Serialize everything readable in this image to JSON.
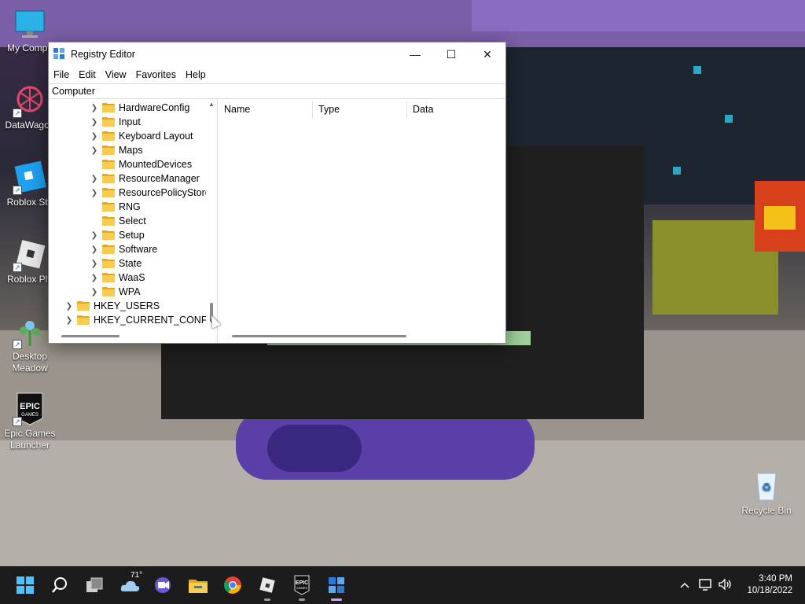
{
  "desktop": {
    "icons": [
      {
        "name": "My Compu",
        "label": "My Compu"
      },
      {
        "name": "DataWagon",
        "label": "DataWagon"
      },
      {
        "name": "Roblox Studio",
        "label": "Roblox Stu"
      },
      {
        "name": "Roblox Player",
        "label": "Roblox Pla"
      },
      {
        "name": "Desktop Meadow",
        "label": "Desktop Meadow"
      },
      {
        "name": "Epic Games Launcher",
        "label": "Epic Games Launcher",
        "badge": "EPIC GAMES"
      },
      {
        "name": "Recycle Bin",
        "label": "Recycle Bin"
      }
    ]
  },
  "window": {
    "title": "Registry Editor",
    "controls": {
      "minimize": "—",
      "maximize": "☐",
      "close": "✕"
    },
    "menu": [
      "File",
      "Edit",
      "View",
      "Favorites",
      "Help"
    ],
    "address": "Computer",
    "tree": [
      {
        "label": "HardwareConfig",
        "expandable": true,
        "level": 2
      },
      {
        "label": "Input",
        "expandable": true,
        "level": 2
      },
      {
        "label": "Keyboard Layout",
        "expandable": true,
        "level": 2
      },
      {
        "label": "Maps",
        "expandable": true,
        "level": 2
      },
      {
        "label": "MountedDevices",
        "expandable": false,
        "level": 2
      },
      {
        "label": "ResourceManager",
        "expandable": true,
        "level": 2
      },
      {
        "label": "ResourcePolicyStore",
        "expandable": true,
        "level": 2
      },
      {
        "label": "RNG",
        "expandable": false,
        "level": 2
      },
      {
        "label": "Select",
        "expandable": false,
        "level": 2
      },
      {
        "label": "Setup",
        "expandable": true,
        "level": 2
      },
      {
        "label": "Software",
        "expandable": true,
        "level": 2
      },
      {
        "label": "State",
        "expandable": true,
        "level": 2
      },
      {
        "label": "WaaS",
        "expandable": true,
        "level": 2
      },
      {
        "label": "WPA",
        "expandable": true,
        "level": 2
      },
      {
        "label": "HKEY_USERS",
        "expandable": true,
        "level": 1
      },
      {
        "label": "HKEY_CURRENT_CONFIG",
        "expandable": true,
        "level": 1
      }
    ],
    "columns": [
      "Name",
      "Type",
      "Data"
    ]
  },
  "taskbar": {
    "weather_temp": "71°",
    "epic_badge": "EPIC GAMES",
    "apps": [
      "start-icon",
      "search-icon",
      "task-view-icon",
      "weather-icon",
      "meet-icon",
      "file-explorer-icon",
      "chrome-icon",
      "roblox-icon",
      "epic-games-icon",
      "regedit-icon"
    ]
  },
  "clock": {
    "time": "3:40 PM",
    "date": "10/18/2022"
  }
}
